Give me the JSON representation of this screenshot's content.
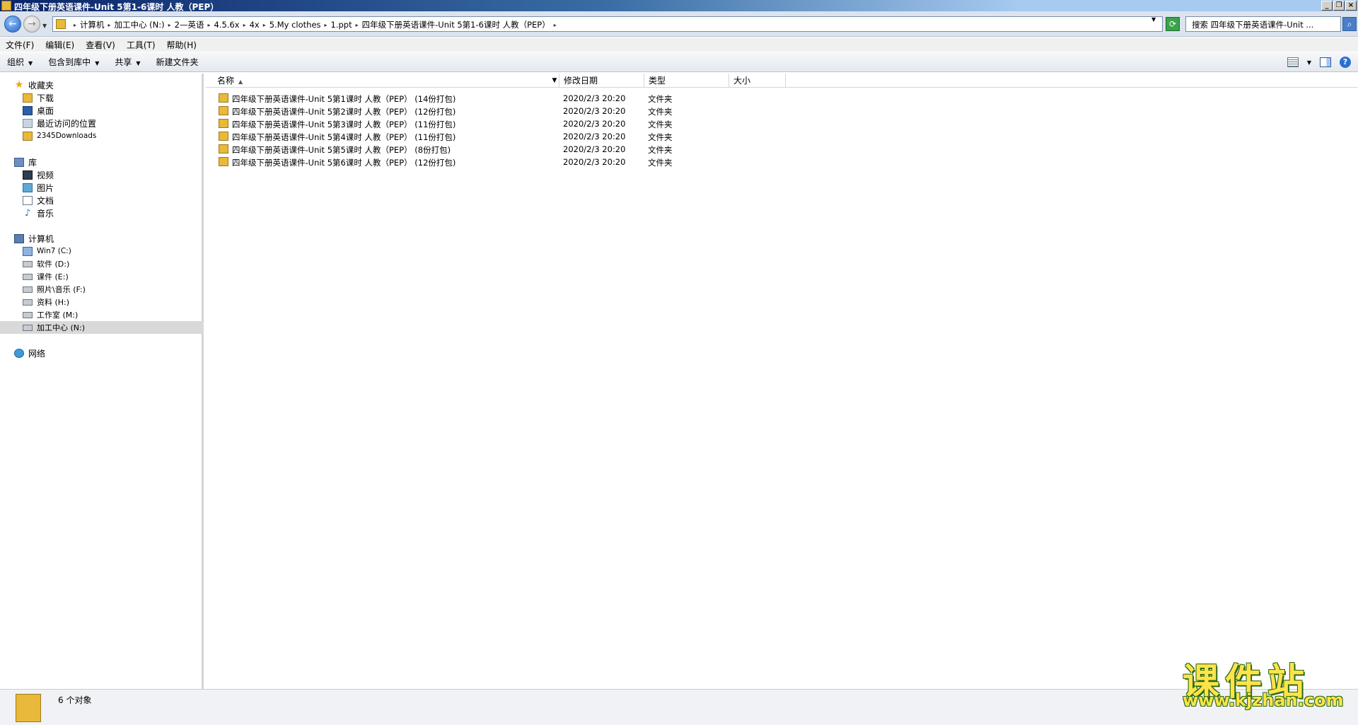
{
  "window": {
    "title": "四年级下册英语课件-Unit 5第1-6课时 人教（PEP）",
    "minimize": "_",
    "restore": "❐",
    "close": "×"
  },
  "address": {
    "crumbs": [
      "计算机",
      "加工中心 (N:)",
      "2—英语",
      "4.5.6x",
      "4x",
      "5.My clothes",
      "1.ppt",
      "四年级下册英语课件-Unit 5第1-6课时 人教（PEP）"
    ],
    "search_text": "搜索 四年级下册英语课件-Unit ..."
  },
  "menu": [
    "文件(F)",
    "编辑(E)",
    "查看(V)",
    "工具(T)",
    "帮助(H)"
  ],
  "toolbar": {
    "organize": "组织",
    "include_in_library": "包含到库中",
    "share": "共享",
    "new_folder": "新建文件夹"
  },
  "nav": {
    "favorites": "收藏夹",
    "fav_items": [
      "下载",
      "桌面",
      "最近访问的位置",
      "2345Downloads"
    ],
    "libraries": "库",
    "lib_items": [
      "视频",
      "图片",
      "文档",
      "音乐"
    ],
    "computer": "计算机",
    "drives": [
      "Win7 (C:)",
      "软件 (D:)",
      "课件 (E:)",
      "照片\\音乐 (F:)",
      "资料 (H:)",
      "工作室 (M:)",
      "加工中心 (N:)"
    ],
    "network": "网络"
  },
  "columns": {
    "name": "名称",
    "date": "修改日期",
    "type": "类型",
    "size": "大小"
  },
  "files": [
    {
      "name": "四年级下册英语课件-Unit 5第1课时 人教（PEP） (14份打包)",
      "date": "2020/2/3 20:20",
      "type": "文件夹"
    },
    {
      "name": "四年级下册英语课件-Unit 5第2课时 人教（PEP） (12份打包)",
      "date": "2020/2/3 20:20",
      "type": "文件夹"
    },
    {
      "name": "四年级下册英语课件-Unit 5第3课时 人教（PEP） (11份打包)",
      "date": "2020/2/3 20:20",
      "type": "文件夹"
    },
    {
      "name": "四年级下册英语课件-Unit 5第4课时 人教（PEP） (11份打包)",
      "date": "2020/2/3 20:20",
      "type": "文件夹"
    },
    {
      "name": "四年级下册英语课件-Unit 5第5课时 人教（PEP） (8份打包)",
      "date": "2020/2/3 20:20",
      "type": "文件夹"
    },
    {
      "name": "四年级下册英语课件-Unit 5第6课时 人教（PEP） (12份打包)",
      "date": "2020/2/3 20:20",
      "type": "文件夹"
    }
  ],
  "status": {
    "count_text": "6 个对象"
  },
  "watermark": {
    "title": "课件站",
    "url": "www.kjzhan.com"
  }
}
